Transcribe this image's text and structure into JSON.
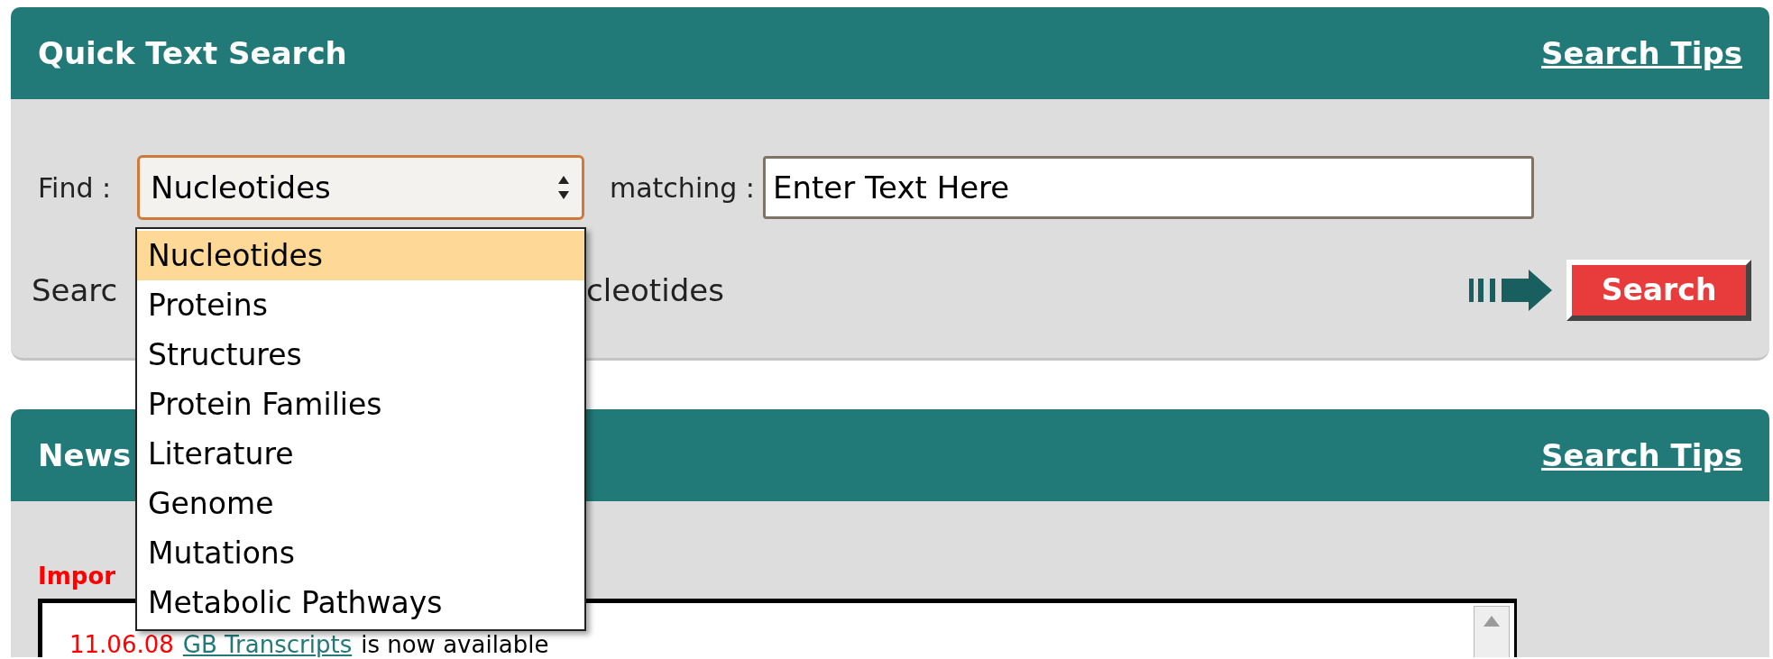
{
  "quick_search": {
    "title": "Quick Text Search",
    "tips_link": "Search Tips",
    "find_label": "Find :",
    "select": {
      "value": "Nucleotides",
      "expanded": true
    },
    "matching_label": "matching :",
    "input": {
      "value": "Enter Text Here"
    },
    "hint_parts": [
      "Searc",
      "cleotides"
    ],
    "search_button": "Search"
  },
  "dropdown": {
    "options": [
      {
        "label": "Nucleotides",
        "selected": true
      },
      {
        "label": "Proteins",
        "selected": false
      },
      {
        "label": "Structures",
        "selected": false
      },
      {
        "label": "Protein Families",
        "selected": false
      },
      {
        "label": "Literature",
        "selected": false
      },
      {
        "label": "Genome",
        "selected": false
      },
      {
        "label": "Mutations",
        "selected": false
      },
      {
        "label": "Metabolic Pathways",
        "selected": false
      }
    ]
  },
  "news": {
    "title": "News",
    "tips_link": "Search Tips",
    "important_label": "Impor",
    "items": [
      {
        "date": "11.06.08",
        "link": "GB Transcripts",
        "text": "is now available"
      }
    ]
  }
}
